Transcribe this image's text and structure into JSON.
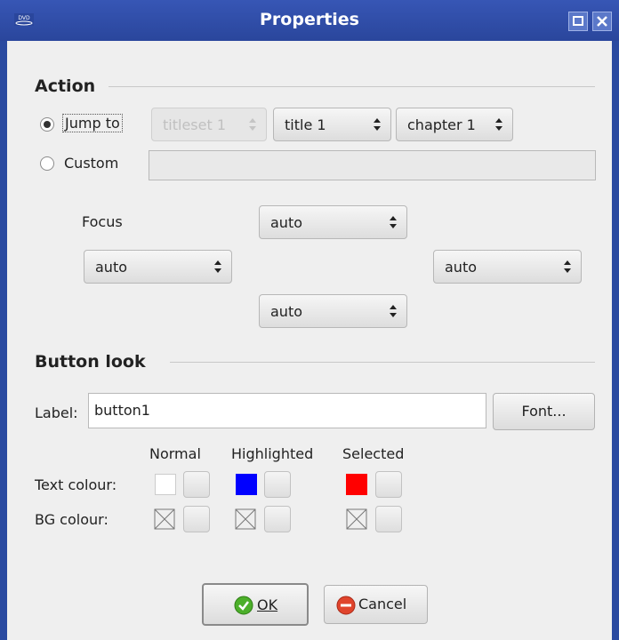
{
  "window": {
    "title": "Properties"
  },
  "action": {
    "heading": "Action",
    "jump_to_label": "Jump to",
    "custom_label": "Custom",
    "titleset_value": "titleset 1",
    "title_value": "title 1",
    "chapter_value": "chapter 1",
    "custom_value": ""
  },
  "focus": {
    "label": "Focus",
    "up_value": "auto",
    "left_value": "auto",
    "right_value": "auto",
    "down_value": "auto"
  },
  "button_look": {
    "heading": "Button look",
    "label_caption": "Label:",
    "label_value": "button1",
    "font_button": "Font...",
    "col_normal": "Normal",
    "col_highlighted": "Highlighted",
    "col_selected": "Selected",
    "row_text": "Text colour:",
    "row_bg": "BG colour:",
    "text_colors": {
      "normal": "#ffffff",
      "highlighted": "#0000ff",
      "selected": "#ff0000"
    }
  },
  "footer": {
    "ok_label": "OK",
    "cancel_label": "Cancel"
  },
  "icons": {
    "app": "dvd-icon",
    "maximize": "maximize-icon",
    "close": "close-icon",
    "ok": "check-icon",
    "cancel": "cancel-icon"
  }
}
